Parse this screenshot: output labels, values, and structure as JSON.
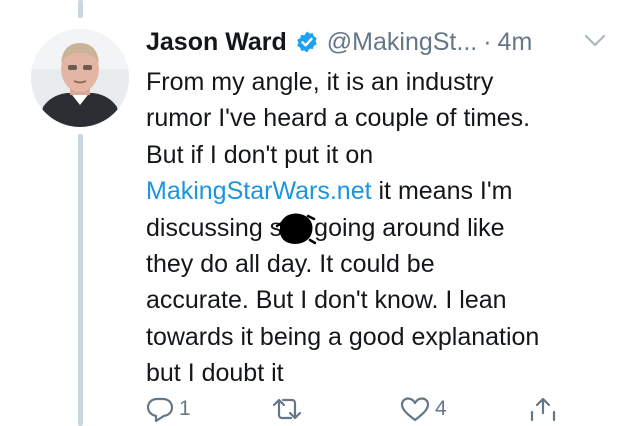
{
  "tweet": {
    "author": {
      "name": "Jason Ward",
      "handle": "@MakingSt...",
      "verified": true,
      "avatar": "avatar"
    },
    "separator": "·",
    "time": "4m",
    "menu_icon": "chevron-down-icon",
    "body": {
      "line1": "From my angle, it is an industry",
      "line2": "rumor I've heard a couple of times.",
      "line3": "But if I don't put it on",
      "line4_link": "MakingStarWars.net",
      "line4_rest": " it means I'm",
      "line5_start": "discussing s",
      "line5_end": "going around like",
      "line6": "they do all day. It could be",
      "line7": "accurate. But I don't know. I lean",
      "line8": "towards it being a good explanation",
      "line9": "but I doubt it"
    },
    "actions": {
      "reply_count": "1",
      "retweet_count": "",
      "like_count": "4"
    }
  },
  "colors": {
    "link": "#1b95e0",
    "verified": "#1da1f2",
    "muted": "#657786",
    "thread_line": "#ccd6dd"
  }
}
